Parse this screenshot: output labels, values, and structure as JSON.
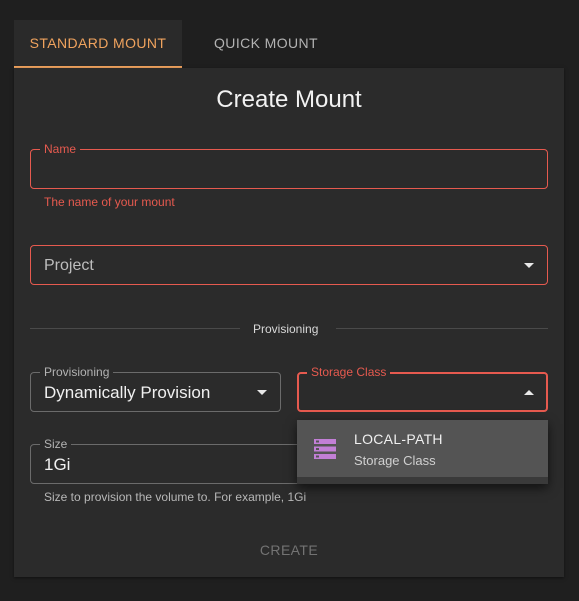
{
  "tabs": [
    {
      "label": "STANDARD MOUNT",
      "active": true
    },
    {
      "label": "QUICK MOUNT",
      "active": false
    }
  ],
  "form": {
    "title": "Create Mount",
    "name": {
      "label": "Name",
      "value": "",
      "helper": "The name of your mount",
      "state": "error"
    },
    "project": {
      "placeholder": "Project",
      "value": ""
    },
    "section_divider": "Provisioning",
    "provisioning": {
      "label": "Provisioning",
      "value": "Dynamically Provision"
    },
    "storage_class": {
      "label": "Storage Class",
      "value": "",
      "open": true
    },
    "size": {
      "label": "Size",
      "value": "1Gi",
      "helper": "Size to provision the volume to. For example, 1Gi"
    },
    "create_label": "CREATE"
  },
  "dropdown": {
    "options": [
      {
        "name": "LOCAL-PATH",
        "subtitle": "Storage Class",
        "icon": "storage-icon",
        "highlighted": true
      }
    ]
  },
  "colors": {
    "accent": "#f0a35e",
    "error": "#e65a4f",
    "icon": "#c27fd6"
  }
}
